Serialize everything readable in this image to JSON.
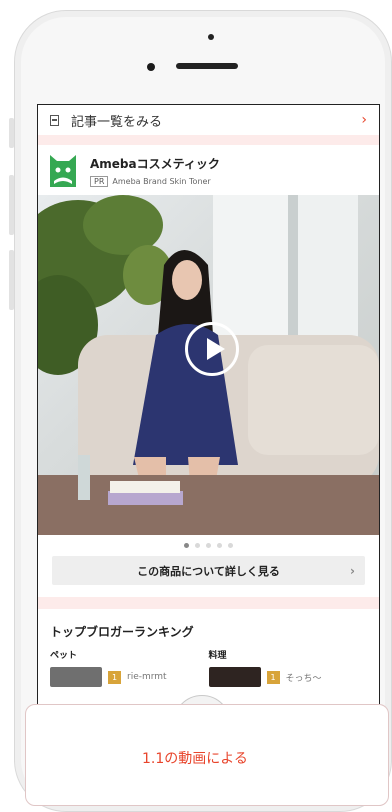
{
  "article_link": {
    "label": "記事一覧をみる",
    "chevron": "›"
  },
  "ad": {
    "brand_title": "Amebaコスメティック",
    "pr_badge": "PR",
    "product_name": "Ameba Brand Skin Toner",
    "logo_color": "#35a852"
  },
  "carousel": {
    "total": 5,
    "active_index": 0
  },
  "detail_button": {
    "label": "この商品について詳しく見る",
    "chevron": "›"
  },
  "ranking": {
    "title": "トップブロガーランキング",
    "columns": [
      {
        "category": "ペット",
        "rank": "1",
        "name": "rie-mrmt"
      },
      {
        "category": "料理",
        "rank": "1",
        "name": "そっち〜"
      }
    ]
  },
  "bottom_card": {
    "text": "1.1の動画による"
  },
  "colors": {
    "accent": "#e8452c",
    "pink_band": "#fdebea",
    "rank_gold": "#d8a43a"
  }
}
